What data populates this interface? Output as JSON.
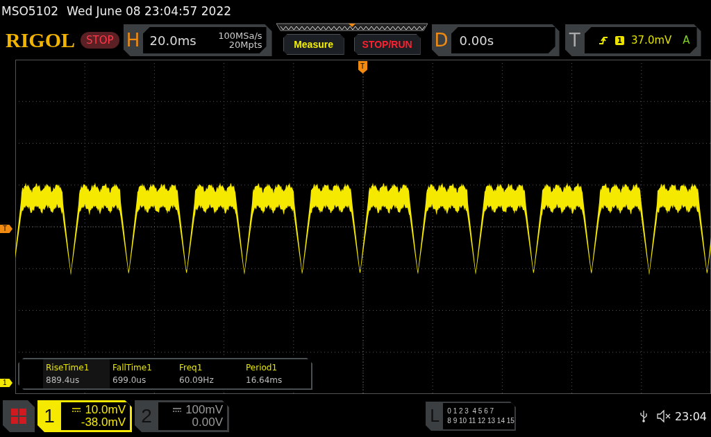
{
  "status_line": {
    "model": "MSO5102",
    "datetime": "Wed June 08 23:04:57 2022"
  },
  "toolbar": {
    "logo": "RIGOL",
    "run_state": "STOP",
    "horizontal": {
      "label": "H",
      "timebase": "20.0ms",
      "sample_rate": "100MSa/s",
      "memory_depth": "20Mpts"
    },
    "buttons": [
      {
        "label": "Measure",
        "kind": "measure"
      },
      {
        "label": "STOP/RUN",
        "kind": "stoprun"
      }
    ],
    "delay": {
      "label": "D",
      "value": "0.00s"
    },
    "trigger": {
      "label": "T",
      "source": "1",
      "level": "37.0mV",
      "mode": "A"
    }
  },
  "display": {
    "trigger_position_marker": "T",
    "trigger_level_marker": "T",
    "channel_marker": "1",
    "measurements": [
      {
        "name": "RiseTime1",
        "value": "889.4us",
        "selected": true
      },
      {
        "name": "FallTime1",
        "value": "699.0us",
        "selected": false
      },
      {
        "name": "Freq1",
        "value": "60.09Hz",
        "selected": false
      },
      {
        "name": "Period1",
        "value": "16.64ms",
        "selected": false
      }
    ]
  },
  "channels": [
    {
      "number": "1",
      "scale": "10.0mV",
      "offset": "-38.0mV",
      "on": true
    },
    {
      "number": "2",
      "scale": "100mV",
      "offset": "0.00V",
      "on": false
    }
  ],
  "logic": {
    "label": "L",
    "bits_row_1": "0 1 2 3  4 5 6 7",
    "bits_row_2": "8 9 10 11 12 13 14 15"
  },
  "status": {
    "time": "23:04"
  }
}
